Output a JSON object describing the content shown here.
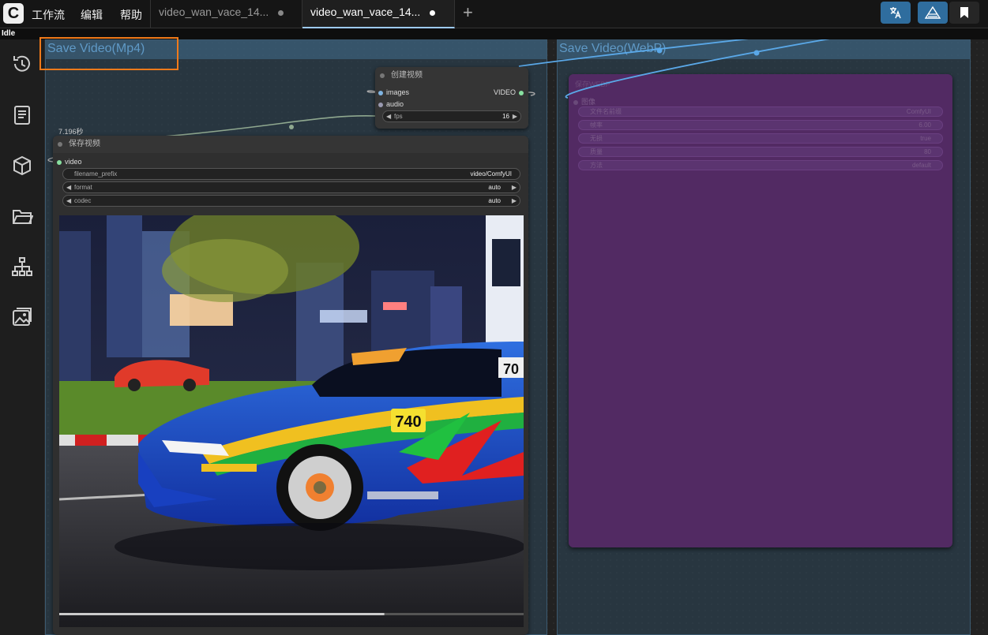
{
  "topbar": {
    "logo_letter": "C",
    "menu": [
      "工作流",
      "编辑",
      "帮助"
    ],
    "tabs": [
      {
        "label": "video_wan_vace_14...",
        "active": false
      },
      {
        "label": "video_wan_vace_14...",
        "active": true
      }
    ],
    "add_tab": "+",
    "buttons": [
      {
        "name": "translate-icon",
        "color": "#2f6d9e"
      },
      {
        "name": "mountain-icon",
        "color": "#2f6d9e"
      },
      {
        "name": "bookmark-icon",
        "color": "#2a2a2a"
      }
    ]
  },
  "status": {
    "text": "Idle"
  },
  "sidebar": {
    "icons": [
      "history-icon",
      "book-icon",
      "cube-icon",
      "folder-icon",
      "sitemap-icon",
      "images-icon"
    ]
  },
  "groups": {
    "left_title": "Save Video(Mp4)",
    "right_title": "Save Video(WebP)"
  },
  "create_video_node": {
    "title": "创建视频",
    "inputs": [
      "images",
      "audio"
    ],
    "output": "VIDEO",
    "fps_label": "fps",
    "fps_value": "16"
  },
  "save_video_node": {
    "time_label": "7.196秒",
    "title": "保存视频",
    "input": "video",
    "widgets": [
      {
        "label": "filename_prefix",
        "value": "video/ComfyUI",
        "arrows": false
      },
      {
        "label": "format",
        "value": "auto",
        "arrows": true
      },
      {
        "label": "codec",
        "value": "auto",
        "arrows": true
      }
    ]
  },
  "webp_node": {
    "title": "保存WEBP",
    "input": "图像",
    "widgets": [
      {
        "label": "文件名前缀",
        "value": "ComfyUI"
      },
      {
        "label": "帧率",
        "value": "6.00"
      },
      {
        "label": "无损",
        "value": "true"
      },
      {
        "label": "质量",
        "value": "80"
      },
      {
        "label": "方法",
        "value": "default"
      }
    ]
  },
  "preview": {
    "car_number": "740",
    "roof_number": "70",
    "progress": 0.7
  },
  "colors": {
    "accent": "#9ecbff",
    "link_blue": "#5aa8e8",
    "highlight": "#f07a1a",
    "group_title": "#5f99c6",
    "webp_node_bg": "#522a63"
  }
}
